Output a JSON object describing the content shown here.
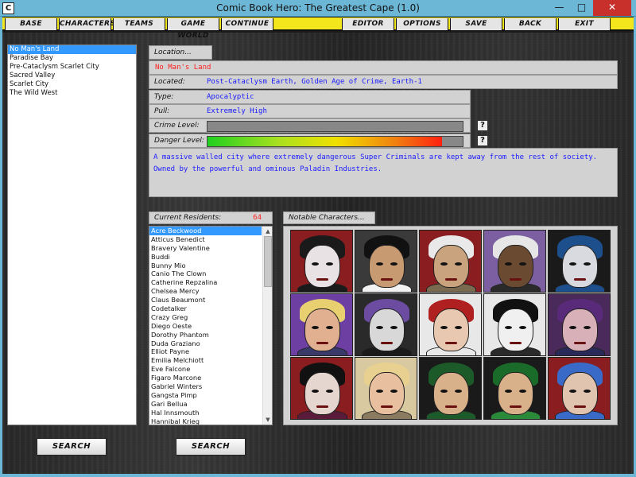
{
  "window": {
    "title": "Comic Book Hero: The Greatest Cape (1.0)",
    "app_icon": "C",
    "controls": {
      "minimize": "—",
      "maximize": "□",
      "close": "✕"
    }
  },
  "menu": [
    {
      "label": "BASE"
    },
    {
      "label": "CHARACTERS"
    },
    {
      "label": "TEAMS"
    },
    {
      "label": "GAME WORLD"
    },
    {
      "label": "CONTINUE"
    },
    {
      "label": "EDITOR"
    },
    {
      "label": "OPTIONS"
    },
    {
      "label": "SAVE"
    },
    {
      "label": "BACK"
    },
    {
      "label": "EXIT"
    }
  ],
  "locations": {
    "items": [
      "No Man's Land",
      "Paradise Bay",
      "Pre-Cataclysm Scarlet City",
      "Sacred Valley",
      "Scarlet City",
      "The Wild West"
    ],
    "selected": "No Man's Land"
  },
  "location": {
    "tab_label": "Location...",
    "name": "No Man's Land",
    "located_label": "Located:",
    "located_value": "Post-Cataclysm Earth, Golden Age of Crime, Earth-1",
    "type_label": "Type:",
    "type_value": "Apocalyptic",
    "pull_label": "Pull:",
    "pull_value": "Extremely High",
    "crime_label": "Crime Level:",
    "crime_level": 0,
    "danger_label": "Danger Level:",
    "danger_level": 0.92,
    "help_icon": "?",
    "description": "A massive walled city where extremely dangerous Super Criminals are kept away from the rest of society. Owned by the powerful and ominous Paladin Industries."
  },
  "residents": {
    "header": "Current Residents:",
    "count": "64",
    "selected": "Acre Beckwood",
    "items": [
      "Acre Beckwood",
      "Atticus Benedict",
      "Bravery Valentine",
      "Buddi",
      "Bunny Mio",
      "Canio The Clown",
      "Catherine Repzalina",
      "Chelsea Mercy",
      "Claus Beaumont",
      "Codetalker",
      "Crazy Greg",
      "Diego Oeste",
      "Dorothy Phantom",
      "Duda Graziano",
      "Elliot Payne",
      "Emilia Melchiott",
      "Eve Falcone",
      "Figaro Marcone",
      "Gabriel Winters",
      "Gangsta Pimp",
      "Gari Bellua",
      "Hal Innsmouth",
      "Hannibal Krieg"
    ],
    "scroll_up": "▲",
    "scroll_down": "▼"
  },
  "notable": {
    "tab_label": "Notable Characters...",
    "portraits": [
      {
        "bg": "#8a1d20",
        "hair": "#1a1a1a",
        "skin": "#e8e2e4",
        "body": "#1a1a1a"
      },
      {
        "bg": "#3a3a3a",
        "hair": "#111111",
        "skin": "#c89a72",
        "body": "#f2f2f2"
      },
      {
        "bg": "#8a1d20",
        "hair": "#e9e9e9",
        "skin": "#c9a37e",
        "body": "#7a6a50"
      },
      {
        "bg": "#7b5fa0",
        "hair": "#e6e6e6",
        "skin": "#6b4a32",
        "body": "#2a2a2a"
      },
      {
        "bg": "#1a1a1a",
        "hair": "#1d4f8c",
        "skin": "#d9d9e0",
        "body": "#1d4f8c"
      },
      {
        "bg": "#6d3fa3",
        "hair": "#e8d070",
        "skin": "#e0b090",
        "body": "#3a3a6a"
      },
      {
        "bg": "#2a2a2a",
        "hair": "#6b4ca0",
        "skin": "#d8d8d8",
        "body": "#1a1a1a"
      },
      {
        "bg": "#e8e8e8",
        "hair": "#b02020",
        "skin": "#e8c8b0",
        "body": "#e8e8e8"
      },
      {
        "bg": "#e8e8e8",
        "hair": "#111111",
        "skin": "#f0f0f0",
        "body": "#2a2a2a"
      },
      {
        "bg": "#4a2a5a",
        "hair": "#5a2a7a",
        "skin": "#d8b0b8",
        "body": "#2a2a5a"
      },
      {
        "bg": "#8a1d20",
        "hair": "#111111",
        "skin": "#e6d6d0",
        "body": "#5a1a3a"
      },
      {
        "bg": "#d9c9a0",
        "hair": "#e8d090",
        "skin": "#e8c0a0",
        "body": "#8a7a60"
      },
      {
        "bg": "#1a1a1a",
        "hair": "#1d5a2a",
        "skin": "#d8b08a",
        "body": "#1d5a2a"
      },
      {
        "bg": "#1a1a1a",
        "hair": "#1a6a2a",
        "skin": "#d8b08a",
        "body": "#2a8a3a"
      },
      {
        "bg": "#8a1d20",
        "hair": "#3a6ac8",
        "skin": "#e0c4b0",
        "body": "#3a6ac8"
      }
    ]
  },
  "buttons": {
    "search_left": "SEARCH",
    "search_right": "SEARCH"
  },
  "colors": {
    "accent_blue": "#1a1aff",
    "alert_red": "#ff2020",
    "menu_yellow": "#f3e61c",
    "selection": "#3399ff"
  }
}
